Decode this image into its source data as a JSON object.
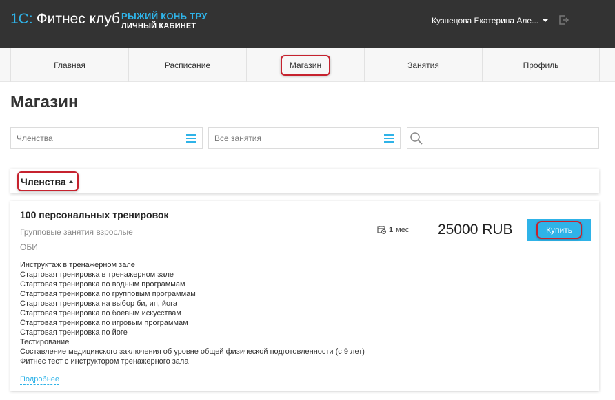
{
  "header": {
    "logo_prefix": "1С:",
    "logo_text": "Фитнес клуб",
    "club_name": "РЫЖИЙ КОНЬ ТРУ",
    "cabinet_label": "ЛИЧНЫЙ КАБИНЕТ",
    "user_name": "Кузнецова Екатерина Але...",
    "user_icon": "chevron-down-icon",
    "logout_icon": "logout-icon"
  },
  "nav": {
    "items": [
      {
        "label": "Главная"
      },
      {
        "label": "Расписание"
      },
      {
        "label": "Магазин",
        "active": true
      },
      {
        "label": "Занятия"
      },
      {
        "label": "Профиль"
      }
    ]
  },
  "page": {
    "title": "Магазин"
  },
  "filters": {
    "category_value": "Членства",
    "activity_value": "Все занятия",
    "search_value": "",
    "list_icon": "menu-icon",
    "search_icon": "search-icon"
  },
  "section": {
    "title": "Членства",
    "toggle_icon": "caret-up-icon"
  },
  "product": {
    "title": "100 персональных тренировок",
    "category": "Групповые занятия взрослые",
    "club": "ОБИ",
    "duration_value": "1",
    "duration_unit": "мес",
    "price": "25000 RUB",
    "buy_label": "Купить",
    "services": [
      "Инструктаж в тренажерном зале",
      "Стартовая тренировка в тренажерном зале",
      "Стартовая тренировка по водным программам",
      "Стартовая тренировка по групповым программам",
      "Стартовая тренировка на выбор би, ип, йога",
      "Стартовая тренировка по боевым искусствам",
      "Стартовая тренировка по игровым программам",
      "Стартовая тренировка по йоге",
      "Тестирование",
      "Составление медицинского заключения об уровне общей физической подготовленности (с 9 лет)",
      "Фитнес тест с инструктором тренажерного зала"
    ],
    "more_label": "Подробнее"
  },
  "colors": {
    "accent": "#2fb3e8",
    "topbar": "#333333",
    "highlight": "#c6222e"
  }
}
